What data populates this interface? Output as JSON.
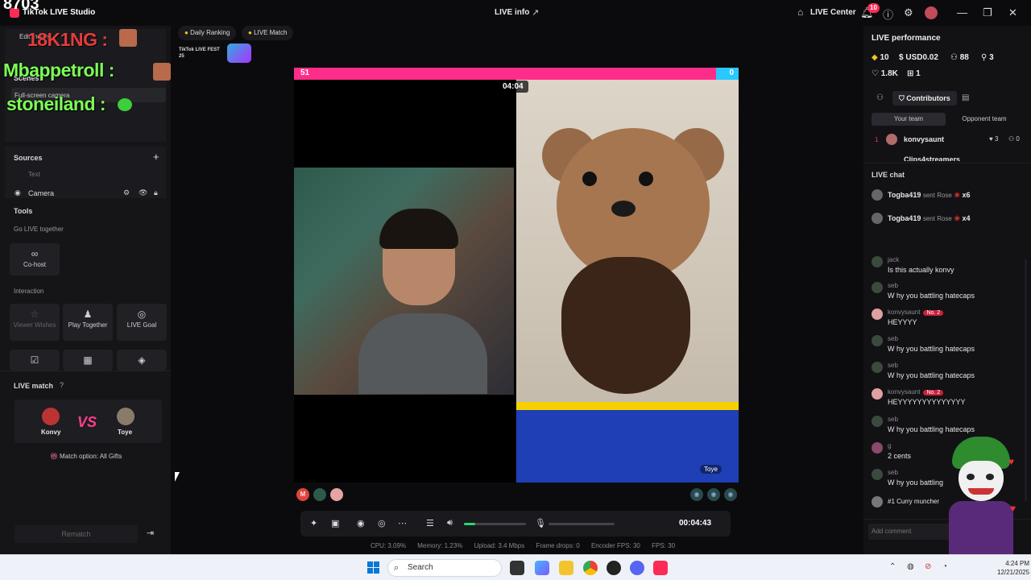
{
  "titlebar": {
    "app_title": "TikTok LIVE Studio",
    "overlay_counter": "8703",
    "live_info": "LIVE info",
    "live_center": "LIVE Center",
    "notif_count": "10"
  },
  "left_panel": {
    "overlay": {
      "name1": "18K1NG :",
      "name2": "Mbappetroll :",
      "name3": "stoneiland :"
    },
    "scenes_title": "Scenes",
    "scene_dropdown": "Edit mode",
    "scene_item": "Full-screen camera",
    "sources_title": "Sources",
    "source_text": "Text",
    "source_camera": "Camera",
    "tools_title": "Tools",
    "go_live_together": "Go LIVE together",
    "cohost": "Co-host",
    "interaction": "Interaction",
    "viewer_wishes": "Viewer Wishes",
    "play_together": "Play Together",
    "live_goal": "LIVE Goal",
    "live_match_title": "LIVE match",
    "player1": "Konvy",
    "player2": "Toye",
    "vs": "VS",
    "match_option": "Match option: All Gifts",
    "rematch": "Rematch"
  },
  "center": {
    "daily_ranking": "Daily Ranking",
    "live_match_pill": "LIVE Match",
    "fest_label": "TikTok LIVE FEST 25",
    "score_left": "51",
    "score_right": "0",
    "timer": "04:04",
    "cam_right_label": "Toye",
    "cohost_initial": "M",
    "duration": "00:04:43",
    "volume_pct": 18,
    "stats": {
      "cpu": "CPU: 3.09%",
      "memory": "Memory: 1.23%",
      "upload": "Upload: 3.4 Mbps",
      "frame_drops": "Frame drops: 0",
      "encoder_fps": "Encoder FPS: 30",
      "fps": "FPS: 30"
    }
  },
  "right_panel": {
    "perf_title": "LIVE performance",
    "diamonds": "10",
    "usd": "USD0.02",
    "viewers": "88",
    "shares": "3",
    "likes": "1.8K",
    "gifts": "1",
    "contributors": "Contributors",
    "your_team": "Your team",
    "opponent_team": "Opponent team",
    "contrib_rank": "1",
    "contrib_name": "konvysaunt",
    "contrib_hearts": "3",
    "contrib_zero": "0",
    "contrib2_name": "Clips4streamers",
    "live_chat_title": "LIVE chat",
    "gift1_user": "Togba419",
    "gift1_sent": "sent Rose",
    "gift1_count": "x6",
    "gift2_user": "Togba419",
    "gift2_sent": "sent Rose",
    "gift2_count": "x4",
    "chat": [
      {
        "user": "jack",
        "text": "Is this actually konvy"
      },
      {
        "user": "seb",
        "text": "W hy you battling hatecaps"
      },
      {
        "user": "konvysaunt",
        "badge": "No. 2",
        "text": "HEYYYY"
      },
      {
        "user": "seb",
        "text": "W hy you battling hatecaps"
      },
      {
        "user": "seb",
        "text": "W hy you battling hatecaps"
      },
      {
        "user": "konvysaunt",
        "badge": "No. 2",
        "text": "HEYYYYYYYYYYYYYY"
      },
      {
        "user": "seb",
        "text": "W hy you battling hatecaps"
      },
      {
        "user": "g",
        "text": "2 cents"
      },
      {
        "user": "seb",
        "text": "W hy you battling"
      }
    ],
    "last_line": "#1 Curry muncher",
    "add_comment": "Add comment"
  },
  "taskbar": {
    "search": "Search",
    "time": "4:24 PM",
    "date": "12/21/2025"
  }
}
